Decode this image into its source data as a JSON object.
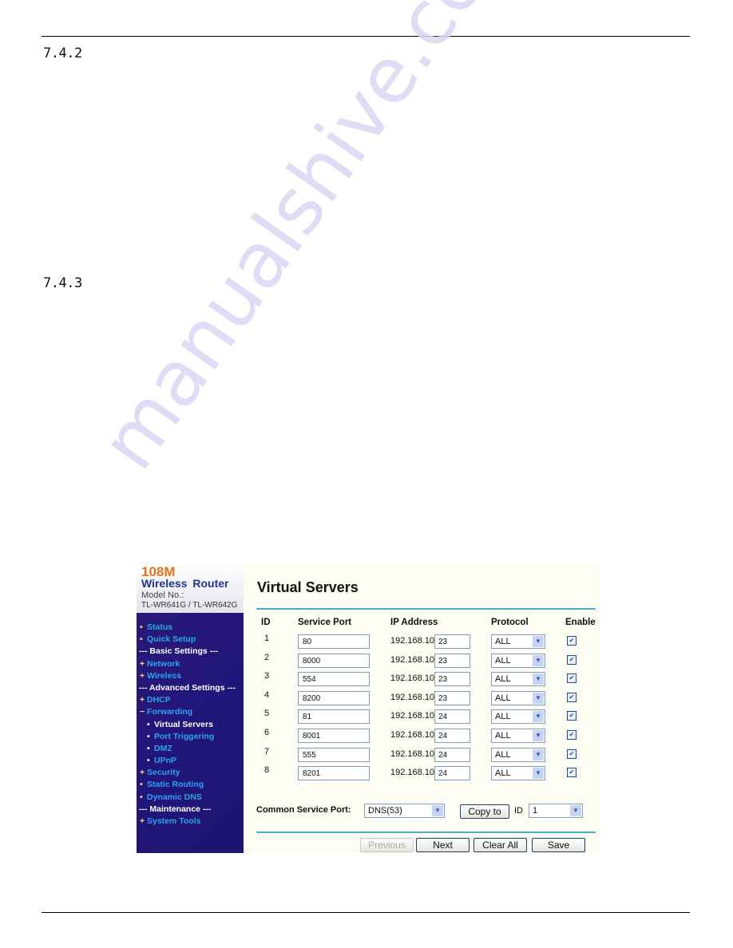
{
  "document": {
    "sections": [
      {
        "number": "7.4.2"
      },
      {
        "number": "7.4.3"
      }
    ],
    "watermark": "manualshive.com"
  },
  "router_ui": {
    "brand": {
      "speed": "108M",
      "product": "Wireless Router",
      "model_label": "Model No.:",
      "model": "TL-WR641G / TL-WR642G"
    },
    "colors": {
      "brand_orange": "#e8721c",
      "brand_navy": "#22348a",
      "sidebar_bg": "#22157a",
      "link_blue": "#2aa6ee",
      "divider_teal": "#4aaecb"
    },
    "sidebar": {
      "items": [
        {
          "label": "Status",
          "marker": "•",
          "type": "link"
        },
        {
          "label": "Quick Setup",
          "marker": "•",
          "type": "link"
        },
        {
          "label": "--- Basic Settings ---",
          "marker": "",
          "type": "header"
        },
        {
          "label": "Network",
          "marker": "+",
          "type": "link"
        },
        {
          "label": "Wireless",
          "marker": "+",
          "type": "link"
        },
        {
          "label": "--- Advanced Settings ---",
          "marker": "",
          "type": "header"
        },
        {
          "label": "DHCP",
          "marker": "+",
          "type": "link"
        },
        {
          "label": "Forwarding",
          "marker": "−",
          "type": "link"
        },
        {
          "label": "Virtual Servers",
          "marker": "•",
          "type": "sub-active"
        },
        {
          "label": "Port Triggering",
          "marker": "•",
          "type": "sub"
        },
        {
          "label": "DMZ",
          "marker": "•",
          "type": "sub"
        },
        {
          "label": "UPnP",
          "marker": "•",
          "type": "sub"
        },
        {
          "label": "Security",
          "marker": "+",
          "type": "link"
        },
        {
          "label": "Static Routing",
          "marker": "•",
          "type": "link"
        },
        {
          "label": "Dynamic DNS",
          "marker": "•",
          "type": "link"
        },
        {
          "label": "--- Maintenance ---",
          "marker": "",
          "type": "header"
        },
        {
          "label": "System Tools",
          "marker": "+",
          "type": "link"
        }
      ]
    },
    "page_title": "Virtual Servers",
    "table": {
      "columns": [
        "ID",
        "Service Port",
        "IP Address",
        "Protocol",
        "Enable"
      ],
      "ip_prefix": "192.168.10.",
      "rows": [
        {
          "id": "1",
          "port": "80",
          "ip_last": "23",
          "protocol": "ALL",
          "enabled": true
        },
        {
          "id": "2",
          "port": "8000",
          "ip_last": "23",
          "protocol": "ALL",
          "enabled": true
        },
        {
          "id": "3",
          "port": "554",
          "ip_last": "23",
          "protocol": "ALL",
          "enabled": true
        },
        {
          "id": "4",
          "port": "8200",
          "ip_last": "23",
          "protocol": "ALL",
          "enabled": true
        },
        {
          "id": "5",
          "port": "81",
          "ip_last": "24",
          "protocol": "ALL",
          "enabled": true
        },
        {
          "id": "6",
          "port": "8001",
          "ip_last": "24",
          "protocol": "ALL",
          "enabled": true
        },
        {
          "id": "7",
          "port": "555",
          "ip_last": "24",
          "protocol": "ALL",
          "enabled": true
        },
        {
          "id": "8",
          "port": "8201",
          "ip_last": "24",
          "protocol": "ALL",
          "enabled": true
        }
      ]
    },
    "common_service_port": {
      "label": "Common Service Port:",
      "value": "DNS(53)",
      "copy_label": "Copy to",
      "id_label": "ID",
      "id_value": "1"
    },
    "buttons": {
      "previous": "Previous",
      "next": "Next",
      "clear_all": "Clear All",
      "save": "Save"
    },
    "icons": {
      "dropdown": "chevron-down-icon",
      "checkbox": "checkbox-checked-icon"
    }
  }
}
